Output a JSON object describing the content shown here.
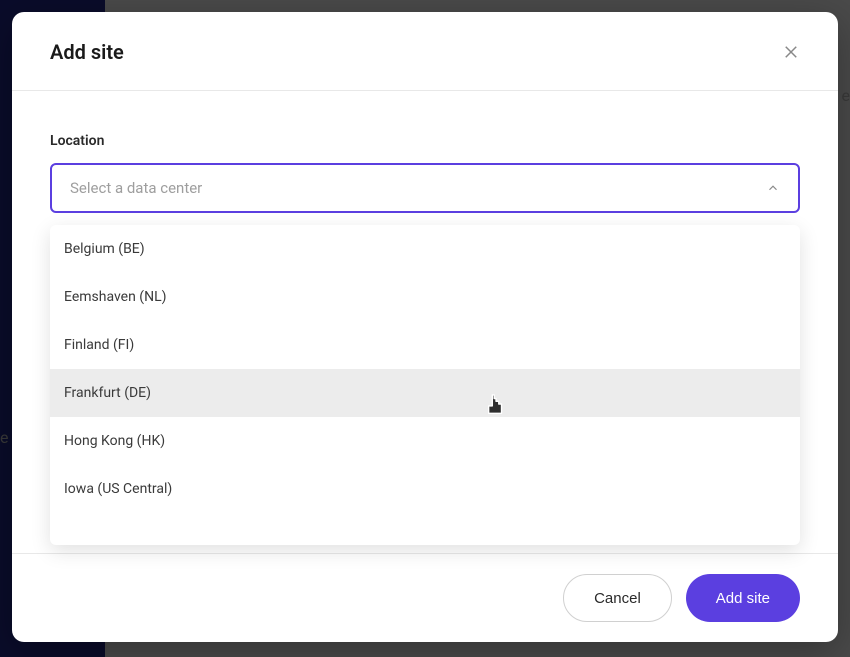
{
  "modal": {
    "title": "Add site",
    "location_label": "Location",
    "select_placeholder": "Select a data center",
    "options": [
      "Belgium (BE)",
      "Eemshaven (NL)",
      "Finland (FI)",
      "Frankfurt (DE)",
      "Hong Kong (HK)",
      "Iowa (US Central)"
    ],
    "hovered_index": 3,
    "footer": {
      "cancel": "Cancel",
      "add": "Add site"
    }
  },
  "bg_text": "e"
}
